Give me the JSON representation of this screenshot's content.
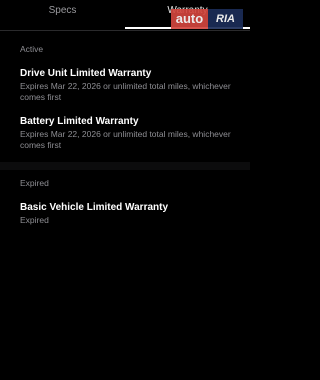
{
  "tabs": [
    {
      "label": "Specs",
      "selected": false
    },
    {
      "label": "Warranty",
      "selected": true
    }
  ],
  "watermark": {
    "part1": "auto",
    "part2": "RIA"
  },
  "active_section": {
    "label": "Active",
    "items": [
      {
        "title": "Drive Unit Limited Warranty",
        "subtitle": "Expires Mar 22, 2026 or unlimited total miles, whichever comes first"
      },
      {
        "title": "Battery Limited Warranty",
        "subtitle": "Expires Mar 22, 2026 or unlimited total miles, whichever comes first"
      }
    ]
  },
  "expired_section": {
    "label": "Expired",
    "items": [
      {
        "title": "Basic Vehicle Limited Warranty",
        "subtitle": "Expired"
      }
    ]
  },
  "colors": {
    "background": "#000000",
    "text_primary": "#ffffff",
    "text_secondary": "#8e8e93",
    "watermark_red": "#d2463e",
    "watermark_blue": "#1c2d58"
  }
}
